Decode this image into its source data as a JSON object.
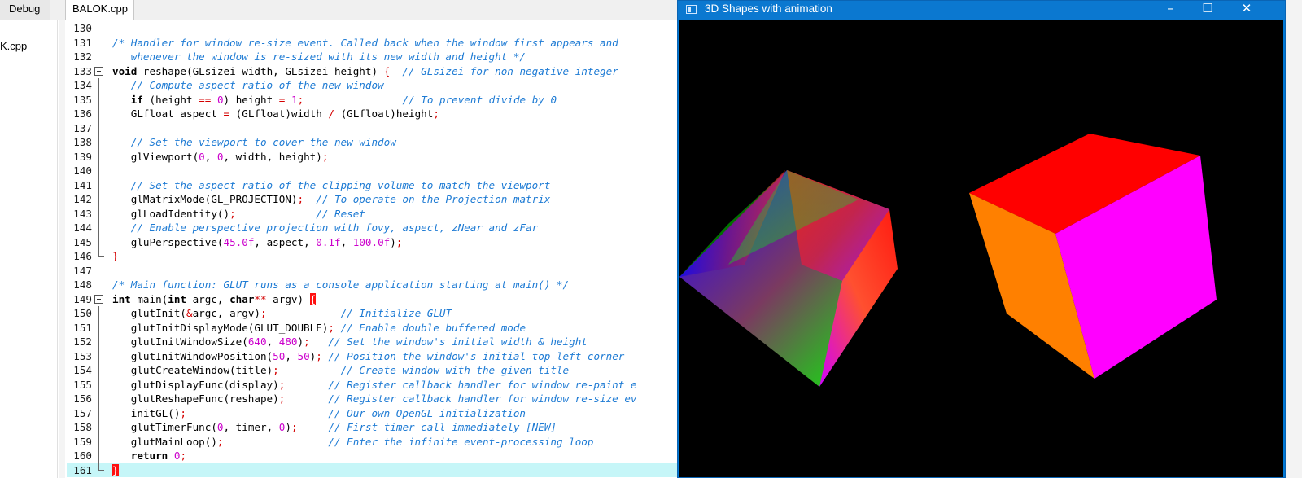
{
  "ide": {
    "tabs": {
      "debug_label": "Debug",
      "file_label": "BALOK.cpp"
    },
    "left_panel_file": "K.cpp",
    "lines": [
      {
        "num": "130",
        "html": ""
      },
      {
        "num": "131",
        "html": "<span class=\"c\">/* Handler for window re-size event. Called back when the window first appears and</span>"
      },
      {
        "num": "132",
        "html": "<span class=\"c\">   whenever the window is re-sized with its new width and height */</span>"
      },
      {
        "num": "133",
        "html": "<span class=\"k\">void</span> reshape(GLsizei width, GLsizei height) <span class=\"o\">{</span>  <span class=\"c\">// GLsizei for non-negative integer</span>"
      },
      {
        "num": "134",
        "html": "   <span class=\"c\">// Compute aspect ratio of the new window</span>"
      },
      {
        "num": "135",
        "html": "   <span class=\"k\">if</span> (height <span class=\"o\">==</span> <span class=\"n\">0</span>) height <span class=\"o\">=</span> <span class=\"n\">1</span><span class=\"o\">;</span>                <span class=\"c\">// To prevent divide by 0</span>"
      },
      {
        "num": "136",
        "html": "   GLfloat aspect <span class=\"o\">=</span> (GLfloat)width <span class=\"o\">/</span> (GLfloat)height<span class=\"o\">;</span>"
      },
      {
        "num": "137",
        "html": ""
      },
      {
        "num": "138",
        "html": "   <span class=\"c\">// Set the viewport to cover the new window</span>"
      },
      {
        "num": "139",
        "html": "   glViewport(<span class=\"n\">0</span>, <span class=\"n\">0</span>, width, height)<span class=\"o\">;</span>"
      },
      {
        "num": "140",
        "html": ""
      },
      {
        "num": "141",
        "html": "   <span class=\"c\">// Set the aspect ratio of the clipping volume to match the viewport</span>"
      },
      {
        "num": "142",
        "html": "   glMatrixMode(GL_PROJECTION)<span class=\"o\">;</span>  <span class=\"c\">// To operate on the Projection matrix</span>"
      },
      {
        "num": "143",
        "html": "   glLoadIdentity()<span class=\"o\">;</span>             <span class=\"c\">// Reset</span>"
      },
      {
        "num": "144",
        "html": "   <span class=\"c\">// Enable perspective projection with fovy, aspect, zNear and zFar</span>"
      },
      {
        "num": "145",
        "html": "   gluPerspective(<span class=\"n\">45.0f</span>, aspect, <span class=\"n\">0.1f</span>, <span class=\"n\">100.0f</span>)<span class=\"o\">;</span>"
      },
      {
        "num": "146",
        "html": "<span class=\"o\">}</span>"
      },
      {
        "num": "147",
        "html": ""
      },
      {
        "num": "148",
        "html": "<span class=\"c\">/* Main function: GLUT runs as a console application starting at main() */</span>"
      },
      {
        "num": "149",
        "html": "<span class=\"k\">int</span> main(<span class=\"k\">int</span> argc, <span class=\"k\">char</span><span class=\"o\">**</span> argv) <span class=\"brm\">{</span>"
      },
      {
        "num": "150",
        "html": "   glutInit(<span class=\"o\">&amp;</span>argc, argv)<span class=\"o\">;</span>            <span class=\"c\">// Initialize GLUT</span>"
      },
      {
        "num": "151",
        "html": "   glutInitDisplayMode(GLUT_DOUBLE)<span class=\"o\">;</span> <span class=\"c\">// Enable double buffered mode</span>"
      },
      {
        "num": "152",
        "html": "   glutInitWindowSize(<span class=\"n\">640</span>, <span class=\"n\">480</span>)<span class=\"o\">;</span>   <span class=\"c\">// Set the window's initial width &amp; height</span>"
      },
      {
        "num": "153",
        "html": "   glutInitWindowPosition(<span class=\"n\">50</span>, <span class=\"n\">50</span>)<span class=\"o\">;</span> <span class=\"c\">// Position the window's initial top-left corner</span>"
      },
      {
        "num": "154",
        "html": "   glutCreateWindow(title)<span class=\"o\">;</span>          <span class=\"c\">// Create window with the given title</span>"
      },
      {
        "num": "155",
        "html": "   glutDisplayFunc(display)<span class=\"o\">;</span>       <span class=\"c\">// Register callback handler for window re-paint e</span>"
      },
      {
        "num": "156",
        "html": "   glutReshapeFunc(reshape)<span class=\"o\">;</span>       <span class=\"c\">// Register callback handler for window re-size ev</span>"
      },
      {
        "num": "157",
        "html": "   initGL()<span class=\"o\">;</span>                       <span class=\"c\">// Our own OpenGL initialization</span>"
      },
      {
        "num": "158",
        "html": "   glutTimerFunc(<span class=\"n\">0</span>, timer, <span class=\"n\">0</span>)<span class=\"o\">;</span>     <span class=\"c\">// First timer call immediately [NEW]</span>"
      },
      {
        "num": "159",
        "html": "   glutMainLoop()<span class=\"o\">;</span>                 <span class=\"c\">// Enter the infinite event-processing loop</span>"
      },
      {
        "num": "160",
        "html": "   <span class=\"k\">return</span> <span class=\"n\">0</span><span class=\"o\">;</span>"
      },
      {
        "num": "161",
        "html": "<span class=\"brm\">}</span>"
      }
    ]
  },
  "glwindow": {
    "title": "3D Shapes with animation",
    "buttons": {
      "minimize": "–",
      "maximize": "☐",
      "close": "✕"
    }
  }
}
